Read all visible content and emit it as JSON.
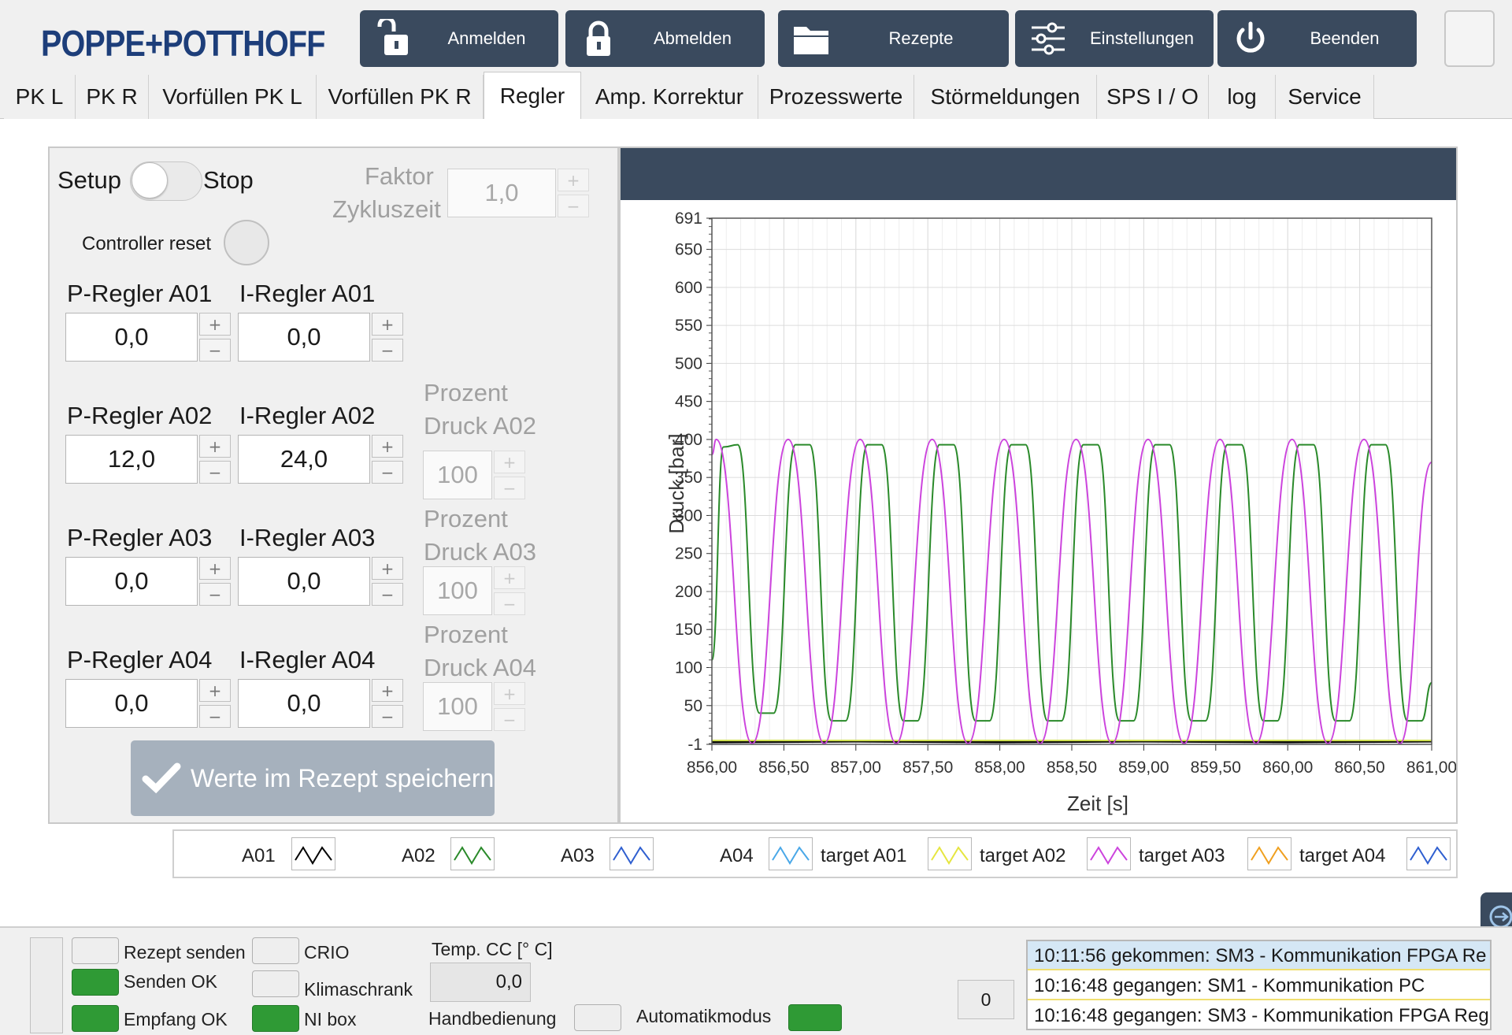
{
  "header": {
    "logo": "POPPE+POTTHOFF",
    "buttons": [
      {
        "label": "Anmelden",
        "icon": "unlocked-padlock-icon"
      },
      {
        "label": "Abmelden",
        "icon": "locked-padlock-icon"
      },
      {
        "label": "Rezepte",
        "icon": "folder-icon"
      },
      {
        "label": "Einstellungen",
        "icon": "sliders-icon"
      },
      {
        "label": "Beenden",
        "icon": "power-icon"
      }
    ]
  },
  "tabs": [
    {
      "label": "PK L",
      "active": false
    },
    {
      "label": "PK R",
      "active": false
    },
    {
      "label": "Vorfüllen PK L",
      "active": false
    },
    {
      "label": "Vorfüllen PK R",
      "active": false
    },
    {
      "label": "Regler",
      "active": true
    },
    {
      "label": "Amp. Korrektur",
      "active": false
    },
    {
      "label": "Prozesswerte",
      "active": false
    },
    {
      "label": "Störmeldungen",
      "active": false
    },
    {
      "label": "SPS I / O",
      "active": false
    },
    {
      "label": "log",
      "active": false
    },
    {
      "label": "Service",
      "active": false
    }
  ],
  "controls": {
    "toggle_left": "Setup",
    "toggle_right": "Stop",
    "faktor_label_1": "Faktor",
    "faktor_label_2": "Zykluszeit",
    "faktor_value": "1,0",
    "reset_label": "Controller reset",
    "spin_plus": "+",
    "spin_minus": "−",
    "regler": [
      {
        "p_label": "P-Regler A01",
        "p_value": "0,0",
        "i_label": "I-Regler A01",
        "i_value": "0,0"
      },
      {
        "p_label": "P-Regler A02",
        "p_value": "12,0",
        "i_label": "I-Regler A02",
        "i_value": "24,0",
        "prozent_label_1": "Prozent",
        "prozent_label_2": "Druck A02",
        "prozent_value": "100"
      },
      {
        "p_label": "P-Regler A03",
        "p_value": "0,0",
        "i_label": "I-Regler A03",
        "i_value": "0,0",
        "prozent_label_1": "Prozent",
        "prozent_label_2": "Druck A03",
        "prozent_value": "100"
      },
      {
        "p_label": "P-Regler A04",
        "p_value": "0,0",
        "i_label": "I-Regler A04",
        "i_value": "0,0",
        "prozent_label_1": "Prozent",
        "prozent_label_2": "Druck A04",
        "prozent_value": "100"
      }
    ],
    "save_label": "Werte im Rezept speichern"
  },
  "chart_data": {
    "type": "line",
    "xlabel": "Zeit [s]",
    "ylabel": "Druck [bar]",
    "xlim": [
      856.0,
      861.0
    ],
    "ylim": [
      -1,
      691
    ],
    "x_ticks": [
      "856,00",
      "856,50",
      "857,00",
      "857,50",
      "858,00",
      "858,50",
      "859,00",
      "859,50",
      "860,00",
      "860,50",
      "861,00"
    ],
    "y_ticks": [
      691,
      650,
      600,
      550,
      500,
      450,
      400,
      350,
      300,
      250,
      200,
      150,
      100,
      50,
      -1
    ],
    "grid": true,
    "series": [
      {
        "name": "A01",
        "color": "#000000",
        "x": [
          856.0,
          857.0,
          858.0,
          859.0,
          860.0,
          861.0
        ],
        "values": [
          2,
          3,
          2,
          3,
          2,
          3
        ]
      },
      {
        "name": "target A02",
        "color": "#cfe04a",
        "x": [
          856.0,
          858.0,
          860.0,
          861.0
        ],
        "values": [
          4,
          4,
          4,
          4
        ]
      },
      {
        "name": "A02",
        "color": "#2a8a2a",
        "x": [
          856.0,
          856.08,
          856.18,
          856.33,
          856.43,
          856.58,
          856.68,
          856.83,
          856.93,
          857.08,
          857.18,
          857.33,
          857.43,
          857.58,
          857.68,
          857.83,
          857.93,
          858.08,
          858.18,
          858.33,
          858.43,
          858.58,
          858.68,
          858.83,
          858.93,
          859.08,
          859.18,
          859.33,
          859.43,
          859.58,
          859.68,
          859.83,
          859.93,
          860.08,
          860.18,
          860.33,
          860.43,
          860.58,
          860.68,
          860.83,
          860.93,
          861.0
        ],
        "values": [
          110,
          390,
          393,
          40,
          40,
          393,
          393,
          30,
          30,
          393,
          393,
          30,
          30,
          393,
          393,
          30,
          30,
          393,
          393,
          30,
          30,
          393,
          393,
          30,
          30,
          393,
          393,
          30,
          30,
          393,
          393,
          30,
          30,
          393,
          393,
          30,
          30,
          393,
          393,
          30,
          30,
          80
        ]
      },
      {
        "name": "target A03",
        "color": "#cc44dd",
        "x": [
          856.0,
          856.03,
          856.28,
          856.53,
          856.78,
          857.03,
          857.28,
          857.53,
          857.78,
          858.03,
          858.28,
          858.53,
          858.78,
          859.03,
          859.28,
          859.53,
          859.78,
          860.03,
          860.28,
          860.53,
          860.78,
          861.0
        ],
        "values": [
          380,
          400,
          0,
          400,
          0,
          400,
          0,
          400,
          0,
          400,
          0,
          400,
          0,
          400,
          0,
          400,
          0,
          400,
          0,
          400,
          0,
          370
        ]
      }
    ],
    "legend": [
      "A01",
      "A02",
      "A03",
      "A04",
      "target A01",
      "target A02",
      "target A03",
      "target A04"
    ],
    "legend_colors": [
      "#000000",
      "#2a8a2a",
      "#2f5fd0",
      "#4aa8e8",
      "#e6e640",
      "#cc44dd",
      "#f0a020",
      "#2f5fd0"
    ]
  },
  "status": {
    "rezept_senden": "Rezept senden",
    "senden_ok": "Senden OK",
    "empfang_ok": "Empfang OK",
    "crio": "CRIO",
    "klimaschrank": "Klimaschrank",
    "ni_box": "NI box",
    "temp_label": "Temp. CC [° C]",
    "temp_value": "0,0",
    "handbedienung": "Handbedienung",
    "automatikmodus": "Automatikmodus",
    "msg_count": "0",
    "messages": [
      "10:11:56 gekommen: SM3 - Kommunikation FPGA Re",
      "10:16:48 gegangen: SM1 - Kommunikation PC",
      "10:16:48 gegangen: SM3 - Kommunikation FPGA Reg"
    ]
  }
}
